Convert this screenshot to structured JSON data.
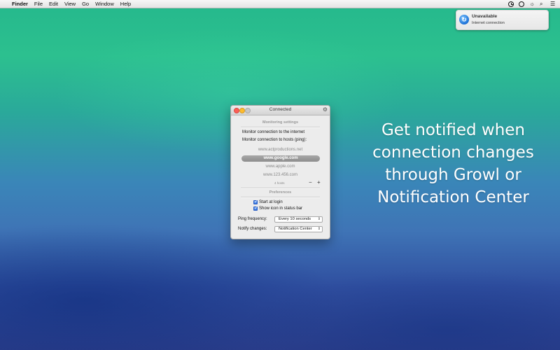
{
  "menubar": {
    "app_name": "Finder",
    "items": [
      "File",
      "Edit",
      "View",
      "Go",
      "Window",
      "Help"
    ],
    "tray_icons": [
      "clock-icon",
      "status-ring-icon",
      "brightness-icon",
      "search-icon",
      "list-icon"
    ]
  },
  "notification": {
    "icon": "growl-icon",
    "title": "Unavailable",
    "subtitle": "Internet connection"
  },
  "window": {
    "title": "Connected",
    "monitoring_header": "Monitoring settings",
    "monitor_internet": "Monitor connection to the internet",
    "monitor_hosts": "Monitor connection to hosts (ping):",
    "hosts": [
      "www.actproductions.net",
      "www.google.com",
      "www.apple.com",
      "www.123.456.com"
    ],
    "selected_host_index": 1,
    "host_count": "4 hosts",
    "remove_label": "−",
    "add_label": "+",
    "preferences_header": "Preferences",
    "start_at_login": "Start at login",
    "start_at_login_checked": true,
    "show_icon": "Show icon in status bar",
    "show_icon_checked": true,
    "ping_frequency_label": "Ping frequency:",
    "ping_frequency_value": "Every 10 seconds",
    "notify_changes_label": "Notify changes:",
    "notify_changes_value": "Notification Center"
  },
  "promo": {
    "lines": [
      "Get notified when",
      "connection changes",
      "through Growl or",
      "Notification Center"
    ]
  },
  "colors": {
    "desktop_top": "#25b88c",
    "desktop_bottom": "#2a3d8a",
    "close": "#fc5f57",
    "minimize": "#fdbb2e",
    "checkbox": "#2f72df"
  }
}
